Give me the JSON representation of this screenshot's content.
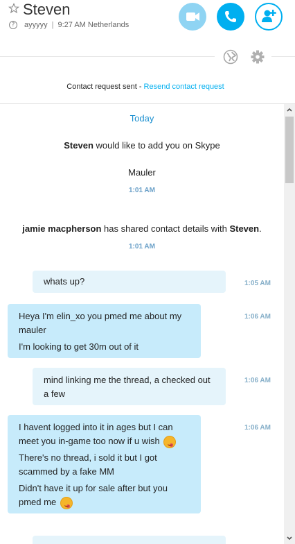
{
  "header": {
    "contact_name": "Steven",
    "mood": "ayyyyy",
    "separator": "|",
    "local_time": "9:27 AM Netherlands",
    "status_icon": "unknown-status-icon",
    "buttons": {
      "video": "video-call-icon",
      "call": "phone-icon",
      "add": "add-participant-icon"
    },
    "colors": {
      "accent": "#00aff0",
      "video_bg": "#8fd4f3"
    }
  },
  "toolbar": {
    "globe_icon": "globe-icon",
    "settings_icon": "gear-icon"
  },
  "contact_request": {
    "text": "Contact request sent - ",
    "link": "Resend contact request"
  },
  "conversation": {
    "day_label": "Today",
    "system_messages": [
      {
        "bold": "Steven",
        "text": " would like to add you on Skype",
        "sub": "Mauler",
        "time": "1:01 AM"
      },
      {
        "bold": "jamie macpherson",
        "text": " has shared contact details with ",
        "bold2": "Steven",
        "end": ".",
        "time": "1:01 AM"
      }
    ],
    "messages": [
      {
        "direction": "out",
        "lines": [
          "whats up?"
        ],
        "time": "1:05 AM"
      },
      {
        "direction": "in",
        "lines": [
          "Heya I'm elin_xo you pmed me about my mauler",
          "I'm looking to get 30m out of it"
        ],
        "time": "1:06 AM"
      },
      {
        "direction": "out",
        "lines": [
          "mind linking me the thread, a checked out a few"
        ],
        "time": "1:06 AM"
      },
      {
        "direction": "in",
        "lines": [
          "I havent logged into it in ages but I can meet you in-game too now if u wish",
          "There's no thread, i sold it but I got scammed by a fake MM",
          "Didn't have it up for sale after but you pmed me"
        ],
        "emoji": "tongue-out-emoji",
        "time": "1:06 AM"
      }
    ]
  }
}
